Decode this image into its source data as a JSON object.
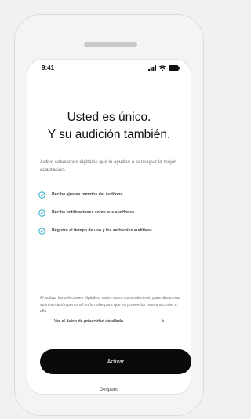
{
  "status_bar": {
    "time": "9:41"
  },
  "title": {
    "line1": "Usted es único.",
    "line2": "Y su audición también."
  },
  "intro": "Active soluciones digitales que lo ayuden a conseguir la mejor adaptación.",
  "benefits": [
    {
      "label": "Reciba ajustes remotos del audífono",
      "icon": "check-circle-icon"
    },
    {
      "label": "Reciba notificaciones sobre sus audífonos",
      "icon": "check-circle-icon"
    },
    {
      "label": "Registre el tiempo de uso y los  ambientes auditivos",
      "icon": "check-circle-icon"
    }
  ],
  "consent_text": "Al activar las soluciones digitales, usted da su consentimiento para almacenar su información personal en la nube para que su proveedor pueda acceder a ella.",
  "privacy_link": {
    "label": "Ver el Aviso de privacidad detallado",
    "chevron": "›"
  },
  "actions": {
    "activate": "Activar",
    "later": "Después"
  },
  "colors": {
    "accent": "#2aa8c8",
    "button": "#0a0a0a"
  }
}
